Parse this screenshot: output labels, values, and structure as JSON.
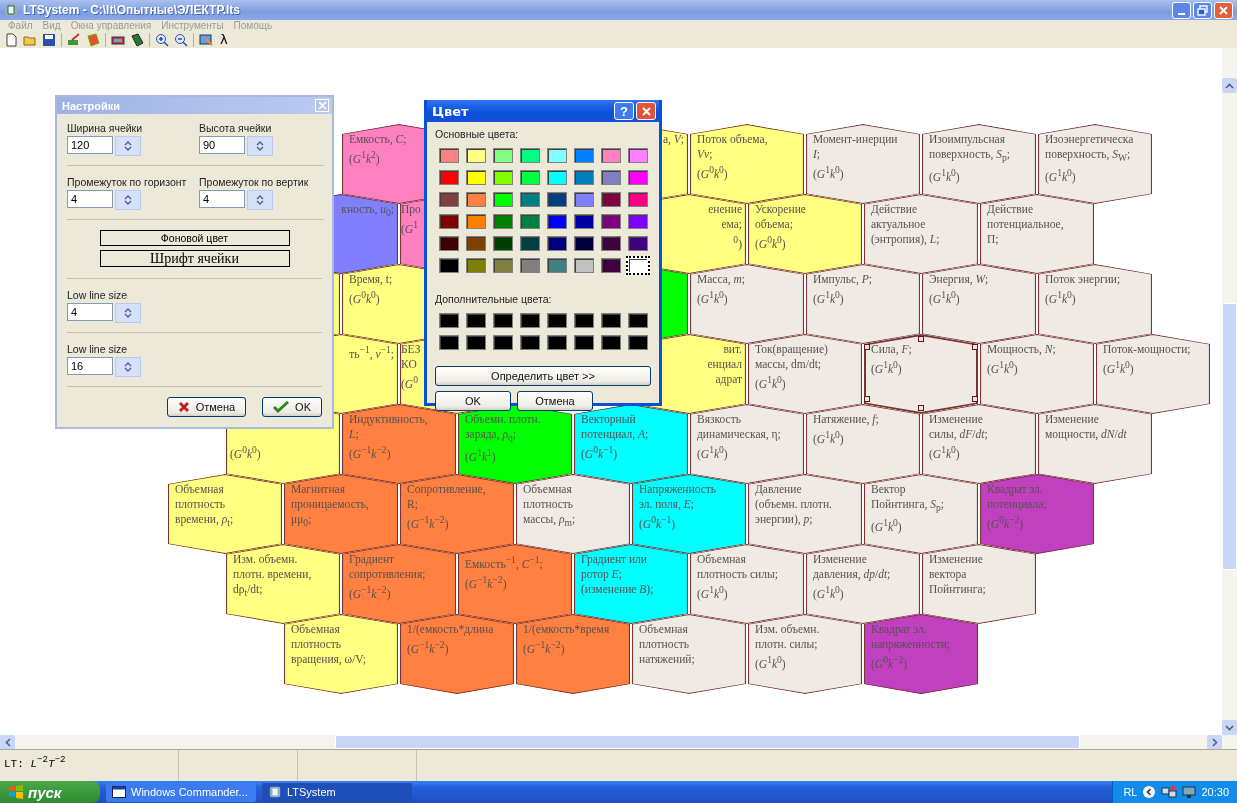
{
  "window": {
    "title": "LTSystem - C:\\lt\\Опытные\\ЭЛЕКТР.lts"
  },
  "menu": [
    "Файл",
    "Вид",
    "Окна управления",
    "Инструменты",
    "Помощь"
  ],
  "toolbar": {
    "lambda": "λ"
  },
  "grid": {
    "rows": [
      {
        "cells": [
          {
            "kind": "blank"
          },
          {
            "kind": "cell",
            "color": "#ff80c0",
            "selected": false,
            "lines": [
              "Емкость, *C*;",
              "(*G*$^{1}$*k*$^{2}$)"
            ]
          },
          {
            "kind": "blank"
          },
          {
            "kind": "fragment",
            "color": "#ffff80",
            "selected": false,
            "lines": [
              "а, *V*;"
            ]
          },
          {
            "kind": "cell",
            "color": "#ffff80",
            "selected": false,
            "lines": [
              "Поток объема,",
              "*Vv*;",
              "(*G*$^{0}$*k*$^{0}$)"
            ]
          },
          {
            "kind": "cell",
            "color": "#efebe4",
            "selected": false,
            "lines": [
              "Момент-инерции",
              "*I*;",
              "(*G*$^{1}$*k*$^{0}$)"
            ]
          },
          {
            "kind": "cell",
            "color": "#efebe4",
            "selected": false,
            "lines": [
              "Изоимпульсная",
              "поверхность, *S*$_{p}$;",
              "(*G*$^{1}$*k*$^{0}$)"
            ]
          },
          {
            "kind": "cell",
            "color": "#efebe4",
            "selected": false,
            "lines": [
              "Изоэнергетическа",
              "поверхность, *S*$_{W}$;",
              "(*G*$^{1}$*k*$^{0}$)"
            ]
          }
        ]
      },
      {
        "cells": [
          {
            "kind": "blank"
          },
          {
            "kind": "fragment",
            "color": "#8080ff",
            "selected": false,
            "lines": [
              "кность, *u*$_{0}$;"
            ]
          },
          {
            "kind": "stub",
            "color": "#ff80c0",
            "selected": false,
            "lines": [
              "Про",
              "(*G*$^{1}$"
            ]
          },
          {
            "kind": "blank"
          },
          {
            "kind": "fragment",
            "color": "#ffff80",
            "selected": false,
            "lines": [
              "енение",
              "ема;",
              "$^{0}$)"
            ]
          },
          {
            "kind": "cell",
            "color": "#ffff80",
            "selected": false,
            "lines": [
              "Ускорение",
              "объема;",
              "(*G*$^{0}$*k*$^{0}$)"
            ]
          },
          {
            "kind": "cell",
            "color": "#efebe4",
            "selected": false,
            "lines": [
              "Действие",
              "актуальное",
              "(энтропия), *L*;"
            ]
          },
          {
            "kind": "cell",
            "color": "#efebe4",
            "selected": false,
            "lines": [
              "Действие",
              "потенциальное,",
              "П;"
            ]
          }
        ]
      },
      {
        "cells": [
          {
            "kind": "cell",
            "color": "#ffff80",
            "selected": false
          },
          {
            "kind": "cell",
            "color": "#ffff80",
            "selected": false,
            "lines": [
              "Время, t;",
              "(*G*$^{0}$*k*$^{0}$)"
            ]
          },
          {
            "kind": "blank"
          },
          {
            "kind": "cell",
            "color": "#00ff00",
            "selected": false
          },
          {
            "kind": "cell",
            "color": "#efebe4",
            "selected": false,
            "lines": [
              "Масса, *m*;",
              "(*G*$^{1}$*k*$^{0}$)"
            ]
          },
          {
            "kind": "cell",
            "color": "#efebe4",
            "selected": false,
            "lines": [
              "Импульс, *P*;",
              "(*G*$^{1}$*k*$^{0}$)"
            ]
          },
          {
            "kind": "cell",
            "color": "#efebe4",
            "selected": false,
            "lines": [
              "Энергия, *W*;",
              "(*G*$^{1}$*k*$^{0}$)"
            ]
          },
          {
            "kind": "cell",
            "color": "#efebe4",
            "selected": false,
            "lines": [
              "Поток энергии;",
              "(*G*$^{1}$*k*$^{0}$)"
            ]
          }
        ]
      },
      {
        "cells": [
          {
            "kind": "blank"
          },
          {
            "kind": "fragment",
            "color": "#ffff80",
            "selected": false,
            "lines": [
              "ть$^{−1}$, *ν*$^{−1}$;"
            ]
          },
          {
            "kind": "stub",
            "color": "#ffff80",
            "selected": false,
            "lines": [
              "БЕЗ",
              "КО",
              "(*G*$^{0}$"
            ]
          },
          {
            "kind": "blank"
          },
          {
            "kind": "fragment",
            "color": "#ffff80",
            "selected": false,
            "lines": [
              "вит.",
              "енциал",
              "адрат"
            ]
          },
          {
            "kind": "cell",
            "color": "#efebe4",
            "selected": false,
            "lines": [
              "Ток(вращение)",
              "массы, dm/dt;",
              "(*G*$^{1}$*k*$^{0}$)"
            ]
          },
          {
            "kind": "cell",
            "color": "#efebe4",
            "selected": true,
            "lines": [
              "Сила, *F*;",
              "(*G*$^{1}$*k*$^{0}$)"
            ]
          },
          {
            "kind": "cell",
            "color": "#efebe4",
            "selected": false,
            "lines": [
              "Мощность, *N*;",
              "(*G*$^{1}$*k*$^{0}$)"
            ]
          },
          {
            "kind": "cell",
            "color": "#efebe4",
            "selected": false,
            "lines": [
              "Поток-мощности;",
              "(*G*$^{1}$*k*$^{0}$)"
            ]
          }
        ]
      },
      {
        "cells": [
          {
            "kind": "tail",
            "color": "#ffff80",
            "selected": false,
            "lines": [
              "(*G*$^{0}$*k*$^{0}$)"
            ]
          },
          {
            "kind": "cell",
            "color": "#ff8040",
            "selected": false,
            "lines": [
              "Индуктивность,",
              "*L*;",
              "(*G*$^{−1}$*k*$^{−2}$)"
            ]
          },
          {
            "kind": "cell",
            "color": "#00ff00",
            "selected": false,
            "lines": [
              "Объемн. плотн.",
              "заряда, *ρ*$_{q}$;",
              "(*G*$^{1}$*k*$^{1}$)"
            ]
          },
          {
            "kind": "cell",
            "color": "#00ffff",
            "selected": false,
            "lines": [
              "Векторный",
              "потенциал, *A*;",
              "(*G*$^{0}$*k*$^{−1}$)"
            ]
          },
          {
            "kind": "cell",
            "color": "#efebe4",
            "selected": false,
            "lines": [
              "Вязкость",
              "динамическая, η;",
              "(*G*$^{1}$*k*$^{0}$)"
            ]
          },
          {
            "kind": "cell",
            "color": "#efebe4",
            "selected": false,
            "lines": [
              "Натяжение, *f*;",
              "(*G*$^{1}$*k*$^{0}$)"
            ]
          },
          {
            "kind": "cell",
            "color": "#efebe4",
            "selected": false,
            "lines": [
              "Изменение",
              "силы, *dF*/*dt*;",
              "(*G*$^{1}$*k*$^{0}$)"
            ]
          },
          {
            "kind": "cell",
            "color": "#efebe4",
            "selected": false,
            "lines": [
              "Изменение",
              "мощности, *dN*/*dt*"
            ]
          }
        ]
      },
      {
        "cells": [
          {
            "kind": "cell",
            "color": "#ffff80",
            "selected": false,
            "lines": [
              "Объемная",
              "плотность",
              "времени, *ρ*$_{t}$;"
            ]
          },
          {
            "kind": "cell",
            "color": "#ff8040",
            "selected": false,
            "lines": [
              "Магнитная",
              "проницаемость,",
              "μμ$_{0}$;"
            ]
          },
          {
            "kind": "cell",
            "color": "#ff8040",
            "selected": false,
            "lines": [
              "Сопротивление,",
              "R;",
              "(*G*$^{−1}$*k*$^{−2}$)"
            ]
          },
          {
            "kind": "cell",
            "color": "#efebe4",
            "selected": false,
            "lines": [
              "Объемная",
              "плотность",
              "массы, *ρ*$_{m}$;"
            ]
          },
          {
            "kind": "cell",
            "color": "#00ffff",
            "selected": false,
            "lines": [
              "Напряженность",
              "эл. поля, *E*;",
              "(*G*$^{0}$*k*$^{−1}$)"
            ]
          },
          {
            "kind": "cell",
            "color": "#efebe4",
            "selected": false,
            "lines": [
              "Давление",
              "(объемн. плотн.",
              "энергии), *p*;"
            ]
          },
          {
            "kind": "cell",
            "color": "#efebe4",
            "selected": false,
            "lines": [
              "Вектор",
              "Пойнтинга, *S*$_{p}$;",
              "(*G*$^{1}$*k*$^{0}$)"
            ]
          },
          {
            "kind": "cell",
            "color": "#c040c0",
            "selected": false,
            "lines": [
              "Квадрат эл.",
              "потенциала;",
              "(*G*$^{0}$*k*$^{−2}$)"
            ]
          }
        ]
      },
      {
        "cells": [
          {
            "kind": "cell",
            "color": "#ffff80",
            "selected": false,
            "lines": [
              "Изм. объемн.",
              "плотн. времени,",
              "dρ$_{t}$/dt;"
            ]
          },
          {
            "kind": "cell",
            "color": "#ff8040",
            "selected": false,
            "lines": [
              "Градиент",
              "сопротивления;",
              "(*G*$^{−1}$*k*$^{−2}$)"
            ]
          },
          {
            "kind": "cell",
            "color": "#ff8040",
            "selected": false,
            "lines": [
              "Емкость$^{−1}$, *C*$^{−1}$;",
              "(*G*$^{−1}$*k*$^{−2}$)"
            ]
          },
          {
            "kind": "cell",
            "color": "#00ffff",
            "selected": false,
            "lines": [
              "Градиент или",
              "ротор *E*;",
              "(изменение *B*);"
            ]
          },
          {
            "kind": "cell",
            "color": "#efebe4",
            "selected": false,
            "lines": [
              "Объемная",
              "плотность силы;",
              "(*G*$^{1}$*k*$^{0}$)"
            ]
          },
          {
            "kind": "cell",
            "color": "#efebe4",
            "selected": false,
            "lines": [
              "Изменение",
              "давления, *dp*/*dt*;",
              "(*G*$^{1}$*k*$^{0}$)"
            ]
          },
          {
            "kind": "cell",
            "color": "#efebe4",
            "selected": false,
            "lines": [
              "Изменение",
              "вектора",
              "Пойнтинга;"
            ]
          }
        ]
      },
      {
        "cells": [
          {
            "kind": "blank"
          },
          {
            "kind": "cell",
            "color": "#ffff80",
            "selected": false,
            "lines": [
              "Объемная",
              "плотность",
              "вращения, ω/V;"
            ]
          },
          {
            "kind": "cell",
            "color": "#ff8040",
            "selected": false,
            "lines": [
              "1/(емкость*длина",
              "(*G*$^{−1}$*k*$^{−2}$)"
            ]
          },
          {
            "kind": "cell",
            "color": "#ff8040",
            "selected": false,
            "lines": [
              "1/(емкость*время",
              "(*G*$^{−1}$*k*$^{−2}$)"
            ]
          },
          {
            "kind": "cell",
            "color": "#efebe4",
            "selected": false,
            "lines": [
              "Объемная",
              "плотность",
              "натяжений;"
            ]
          },
          {
            "kind": "cell",
            "color": "#efebe4",
            "selected": false,
            "lines": [
              "Изм. объемн.",
              "плотн. силы;",
              "(*G*$^{1}$*k*$^{0}$)"
            ]
          },
          {
            "kind": "cell",
            "color": "#c040c0",
            "selected": false,
            "lines": [
              "Квадрат эл.",
              "напряженности;",
              "(*G*$^{0}$*k*$^{−2}$)"
            ]
          }
        ]
      }
    ]
  },
  "settings_dialog": {
    "title": "Настройки",
    "fields": [
      {
        "label": "Ширина ячейки",
        "value": "120"
      },
      {
        "label": "Высота ячейки",
        "value": "90"
      },
      {
        "label": "Промежуток по горизонт",
        "value": "4"
      },
      {
        "label": "Промежуток по вертик",
        "value": "4"
      }
    ],
    "background_button": "Фоновой цвет",
    "font_button": "Шрифт ячейки",
    "line_fields": [
      {
        "label": "Low line size",
        "value": "4"
      },
      {
        "label": "Low line size",
        "value": "16"
      }
    ],
    "cancel": "Отмена",
    "ok": "OK"
  },
  "color_dialog": {
    "title": "Цвет",
    "help": "?",
    "basic_label": "Основные цвета:",
    "basic_colors": [
      {
        "color": "#ff8080",
        "selected": false
      },
      {
        "color": "#ffff80",
        "selected": false
      },
      {
        "color": "#80ff80",
        "selected": false
      },
      {
        "color": "#00ff80",
        "selected": false
      },
      {
        "color": "#80ffff",
        "selected": false
      },
      {
        "color": "#0080ff",
        "selected": false
      },
      {
        "color": "#ff80c0",
        "selected": false
      },
      {
        "color": "#ff80ff",
        "selected": false
      },
      {
        "color": "#ff0000",
        "selected": false
      },
      {
        "color": "#ffff00",
        "selected": false
      },
      {
        "color": "#80ff00",
        "selected": false
      },
      {
        "color": "#00ff40",
        "selected": false
      },
      {
        "color": "#00ffff",
        "selected": false
      },
      {
        "color": "#0080c0",
        "selected": false
      },
      {
        "color": "#8080c0",
        "selected": false
      },
      {
        "color": "#ff00ff",
        "selected": false
      },
      {
        "color": "#804040",
        "selected": false
      },
      {
        "color": "#ff8040",
        "selected": false
      },
      {
        "color": "#00ff00",
        "selected": false
      },
      {
        "color": "#008080",
        "selected": false
      },
      {
        "color": "#004080",
        "selected": false
      },
      {
        "color": "#8080ff",
        "selected": false
      },
      {
        "color": "#800040",
        "selected": false
      },
      {
        "color": "#ff0080",
        "selected": false
      },
      {
        "color": "#800000",
        "selected": false
      },
      {
        "color": "#ff8000",
        "selected": false
      },
      {
        "color": "#008000",
        "selected": false
      },
      {
        "color": "#008040",
        "selected": false
      },
      {
        "color": "#0000ff",
        "selected": false
      },
      {
        "color": "#0000a0",
        "selected": false
      },
      {
        "color": "#800080",
        "selected": false
      },
      {
        "color": "#8000ff",
        "selected": false
      },
      {
        "color": "#400000",
        "selected": false
      },
      {
        "color": "#804000",
        "selected": false
      },
      {
        "color": "#004000",
        "selected": false
      },
      {
        "color": "#004040",
        "selected": false
      },
      {
        "color": "#000080",
        "selected": false
      },
      {
        "color": "#000040",
        "selected": false
      },
      {
        "color": "#400040",
        "selected": false
      },
      {
        "color": "#400080",
        "selected": false
      },
      {
        "color": "#000000",
        "selected": false
      },
      {
        "color": "#808000",
        "selected": false
      },
      {
        "color": "#808040",
        "selected": false
      },
      {
        "color": "#808080",
        "selected": false
      },
      {
        "color": "#408080",
        "selected": false
      },
      {
        "color": "#c0c0c0",
        "selected": false
      },
      {
        "color": "#400040",
        "selected": false
      },
      {
        "color": "#ffffff",
        "selected": true
      }
    ],
    "custom_label": "Дополнительные цвета:",
    "custom_colors": [
      {
        "color": "#000000"
      },
      {
        "color": "#000000"
      },
      {
        "color": "#000000"
      },
      {
        "color": "#000000"
      },
      {
        "color": "#000000"
      },
      {
        "color": "#000000"
      },
      {
        "color": "#000000"
      },
      {
        "color": "#000000"
      },
      {
        "color": "#000000"
      },
      {
        "color": "#000000"
      },
      {
        "color": "#000000"
      },
      {
        "color": "#000000"
      },
      {
        "color": "#000000"
      },
      {
        "color": "#000000"
      },
      {
        "color": "#000000"
      },
      {
        "color": "#000000"
      }
    ],
    "define_button": "Определить цвет >>",
    "ok": "OK",
    "cancel": "Отмена"
  },
  "status_bar": {
    "text": "LT: *L*$^{−2}$*T*$^{−2}$"
  },
  "taskbar": {
    "start": "пуск",
    "tasks": [
      {
        "label": "Windows Commander...",
        "selected": false
      },
      {
        "label": "LTSystem",
        "selected": true
      }
    ],
    "language": "RL",
    "clock": "20:30"
  }
}
